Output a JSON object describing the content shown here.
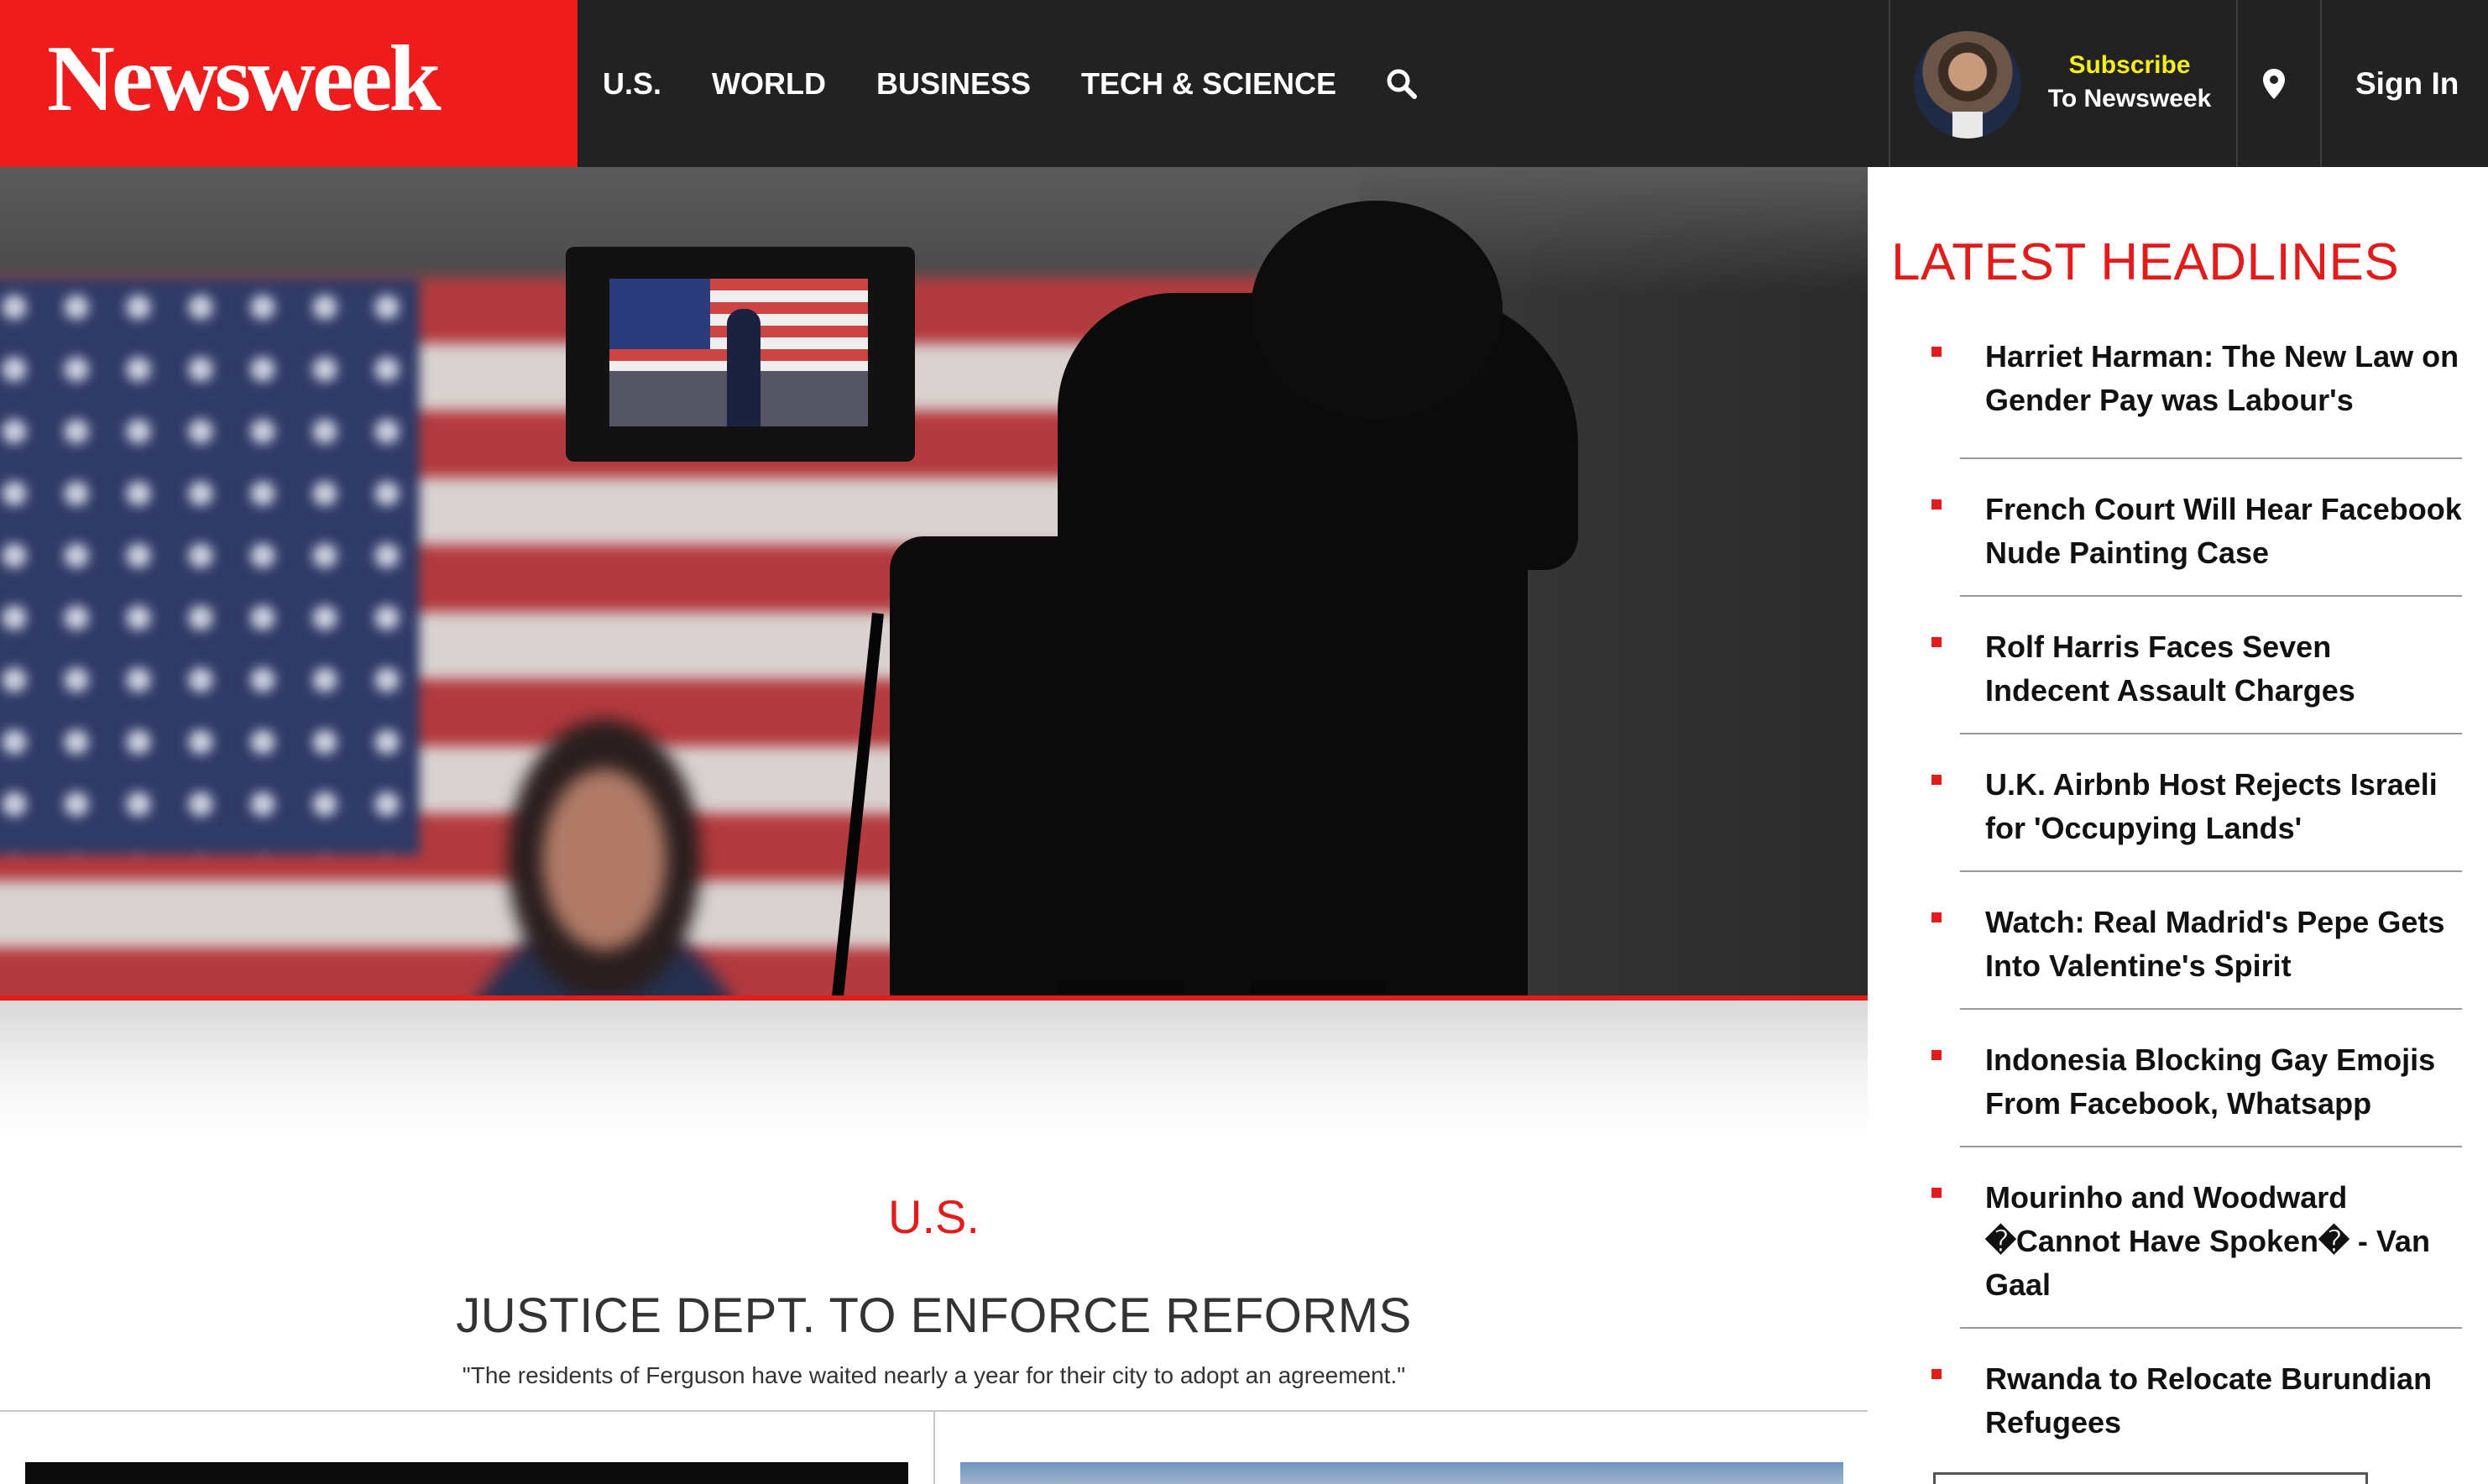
{
  "header": {
    "logo": "Newsweek",
    "nav": [
      "U.S.",
      "WORLD",
      "BUSINESS",
      "TECH & SCIENCE"
    ],
    "search_icon": "search-icon",
    "subscribe_line1": "Subscribe",
    "subscribe_line2": "To Newsweek",
    "location_icon": "map-pin-icon",
    "sign_in": "Sign In"
  },
  "hero": {
    "section": "U.S.",
    "title": "JUSTICE DEPT. TO ENFORCE REFORMS",
    "dek": "\"The residents of Ferguson have waited nearly a year for their city to adopt an agreement.\""
  },
  "sidebar": {
    "title": "LATEST HEADLINES",
    "headlines": [
      "Harriet Harman: The New Law on Gender Pay was Labour's",
      "French Court Will Hear Facebook Nude Painting Case",
      "Rolf Harris Faces Seven Indecent Assault Charges",
      "U.K. Airbnb Host Rejects Israeli for 'Occupying Lands'",
      "Watch: Real Madrid's Pepe Gets Into Valentine's Spirit",
      "Indonesia Blocking Gay Emojis From Facebook, Whatsapp",
      "Mourinho and Woodward �Cannot Have Spoken� - Van Gaal",
      "Rwanda to Relocate Burundian Refugees"
    ]
  },
  "colors": {
    "brand_red": "#ee1c1c",
    "header_bg": "#222222",
    "subscribe_yellow": "#f4ee1c",
    "accent_red": "#e21b1b"
  }
}
